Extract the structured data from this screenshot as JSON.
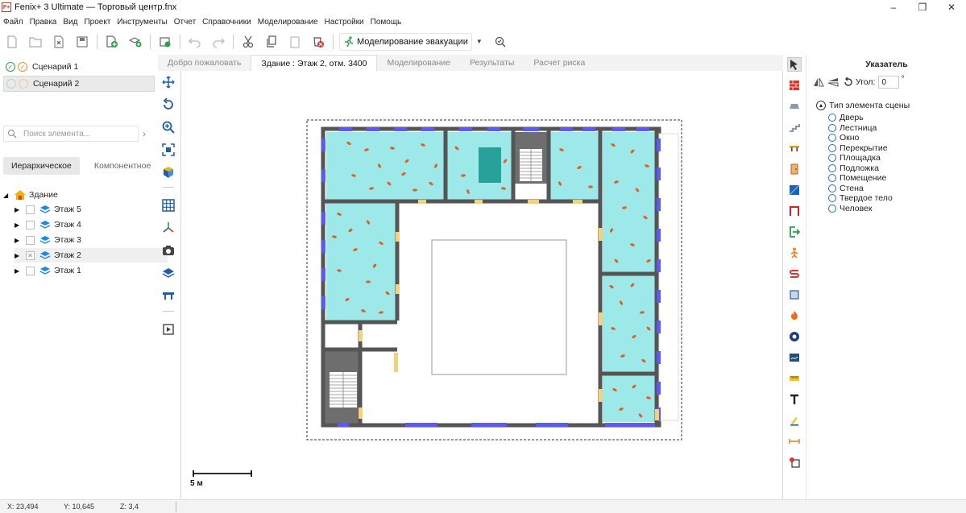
{
  "window": {
    "app_icon": "F+",
    "title": "Fenix+ 3 Ultimate — Торговый центр.fnx",
    "controls": [
      "minimize-icon",
      "restore-icon",
      "close-icon"
    ]
  },
  "menu": [
    "Файл",
    "Правка",
    "Вид",
    "Проект",
    "Инструменты",
    "Отчет",
    "Справочники",
    "Моделирование",
    "Настройки",
    "Помощь"
  ],
  "toolbar": {
    "simulation_label": "Моделирование эвакуации"
  },
  "scenarios": [
    {
      "label": "Сценарий 1",
      "active": true
    },
    {
      "label": "Сценарий 2",
      "active": false
    }
  ],
  "search": {
    "placeholder": "Поиск элемента..."
  },
  "view_tabs": [
    {
      "label": "Иерархическое",
      "active": true
    },
    {
      "label": "Компонентное",
      "active": false
    }
  ],
  "tree": {
    "root": "Здание",
    "floors": [
      {
        "label": "Этаж 5",
        "checked": false,
        "selected": false
      },
      {
        "label": "Этаж 4",
        "checked": false,
        "selected": false
      },
      {
        "label": "Этаж 3",
        "checked": false,
        "selected": false
      },
      {
        "label": "Этаж 2",
        "checked": true,
        "selected": true
      },
      {
        "label": "Этаж 1",
        "checked": false,
        "selected": false
      }
    ]
  },
  "doc_tabs": [
    {
      "label": "Добро пожаловать",
      "active": false
    },
    {
      "label": "Здание : Этаж 2, отм. 3400",
      "active": true
    },
    {
      "label": "Моделирование",
      "active": false
    },
    {
      "label": "Результаты",
      "active": false
    },
    {
      "label": "Расчет риска",
      "active": false
    }
  ],
  "canvas": {
    "scale_label": "5 м"
  },
  "properties": {
    "title": "Указатель",
    "angle_label": "Угол:",
    "angle_value": "0",
    "degree": "°",
    "section_title": "Тип элемента сцены",
    "element_types": [
      "Дверь",
      "Лестница",
      "Окно",
      "Перекрытие",
      "Площадка",
      "Подложка",
      "Помещение",
      "Стена",
      "Твердое тело",
      "Человек"
    ]
  },
  "status": {
    "x": "X:  23,494",
    "y": "Y:  10,645",
    "z": "Z:  3,4"
  },
  "colors": {
    "room_fill": "#9de9ea",
    "wall": "#555555",
    "window": "#5b5bf0",
    "door": "#f5d27a",
    "person": "#e06020",
    "accent": "#2b6cc4"
  }
}
